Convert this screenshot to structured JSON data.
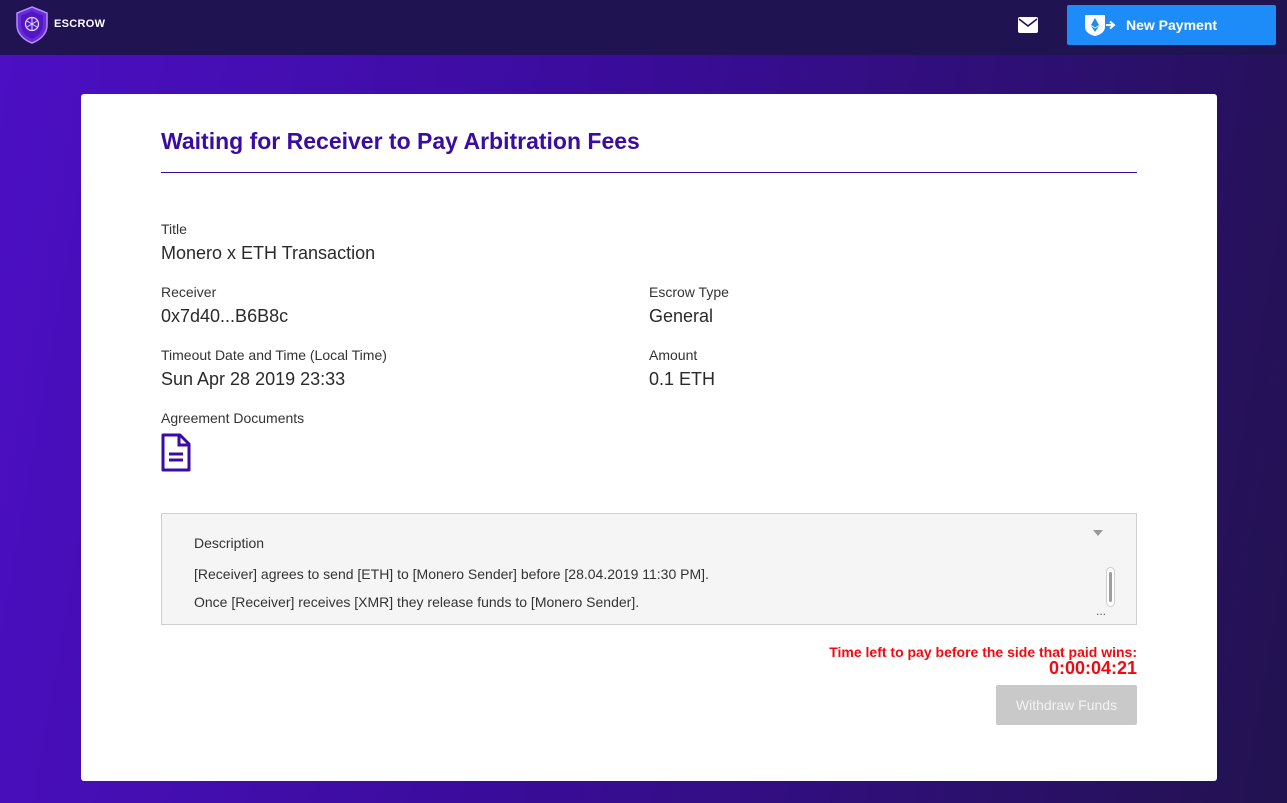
{
  "header": {
    "logo_text": "ESCROW",
    "mail_icon": "envelope-icon",
    "new_payment_label": "New Payment",
    "new_payment_icon": "ethereum-send-icon",
    "colors": {
      "bar": "#1f1352",
      "button": "#1d8cf8"
    }
  },
  "card": {
    "title": "Waiting for Receiver to Pay Arbitration Fees",
    "fields": {
      "title_label": "Title",
      "title_value": "Monero x ETH Transaction",
      "receiver_label": "Receiver",
      "receiver_value": "0x7d40...B6B8c",
      "escrow_type_label": "Escrow Type",
      "escrow_type_value": "General",
      "timeout_label": "Timeout Date and Time (Local Time)",
      "timeout_value": "Sun Apr 28 2019 23:33",
      "amount_label": "Amount",
      "amount_value": "0.1 ETH",
      "documents_label": "Agreement Documents",
      "document_icon": "document-icon"
    },
    "description": {
      "title": "Description",
      "lines": [
        "[Receiver] agrees to send [ETH] to [Monero Sender] before [28.04.2019 11:30 PM].",
        "Once [Receiver] receives [XMR] they release funds to [Monero Sender]."
      ],
      "ellipsis": "..."
    },
    "timer": {
      "label": "Time left to pay before the side that paid wins:",
      "value": "0:00:04:21",
      "color": "#f5080f"
    },
    "withdraw_label": "Withdraw Funds",
    "accent_color": "#3a0ca3"
  }
}
